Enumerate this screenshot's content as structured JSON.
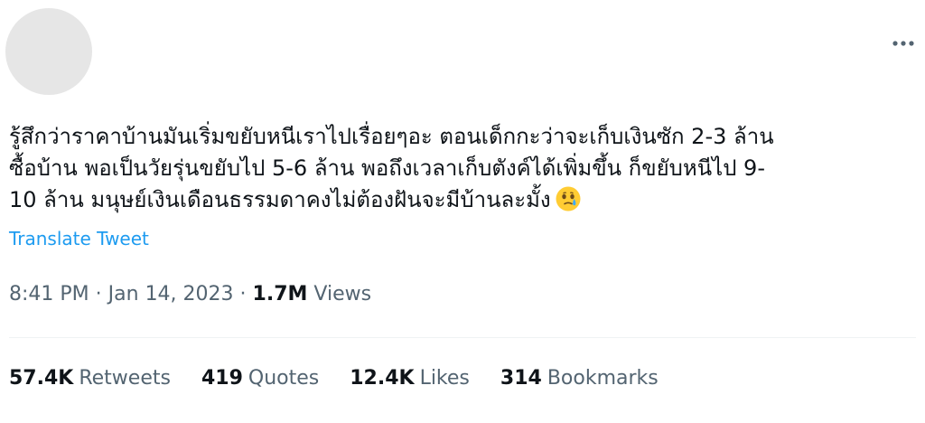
{
  "tweet": {
    "text_lines": [
      "รู้สึกว่าราคาบ้านมันเริ่มขยับหนีเราไปเรื่อยๆอะ ตอนเด็กกะว่าจะเก็บเงินซัก 2-3 ล้าน",
      "ซื้อบ้าน พอเป็นวัยรุ่นขยับไป 5-6 ล้าน พอถึงเวลาเก็บตังค์ได้เพิ่มขึ้น ก็ขยับหนีไป 9-",
      "10 ล้าน มนุษย์เงินเดือนธรรมดาคงไม่ต้องฝันจะมีบ้านละมั้ง"
    ],
    "emoji": "face-holding-back-tears-icon",
    "translate_label": "Translate Tweet",
    "time": "8:41 PM",
    "date": "Jan 14, 2023",
    "separator": "·",
    "views_count": "1.7M",
    "views_label": "Views"
  },
  "stats": [
    {
      "count": "57.4K",
      "label": "Retweets"
    },
    {
      "count": "419",
      "label": "Quotes"
    },
    {
      "count": "12.4K",
      "label": "Likes"
    },
    {
      "count": "314",
      "label": "Bookmarks"
    }
  ],
  "colors": {
    "link": "#1d9bf0",
    "text": "#0f1419",
    "secondary": "#536471",
    "divider": "#eff3f4"
  },
  "icons": {
    "more": "more-icon"
  }
}
